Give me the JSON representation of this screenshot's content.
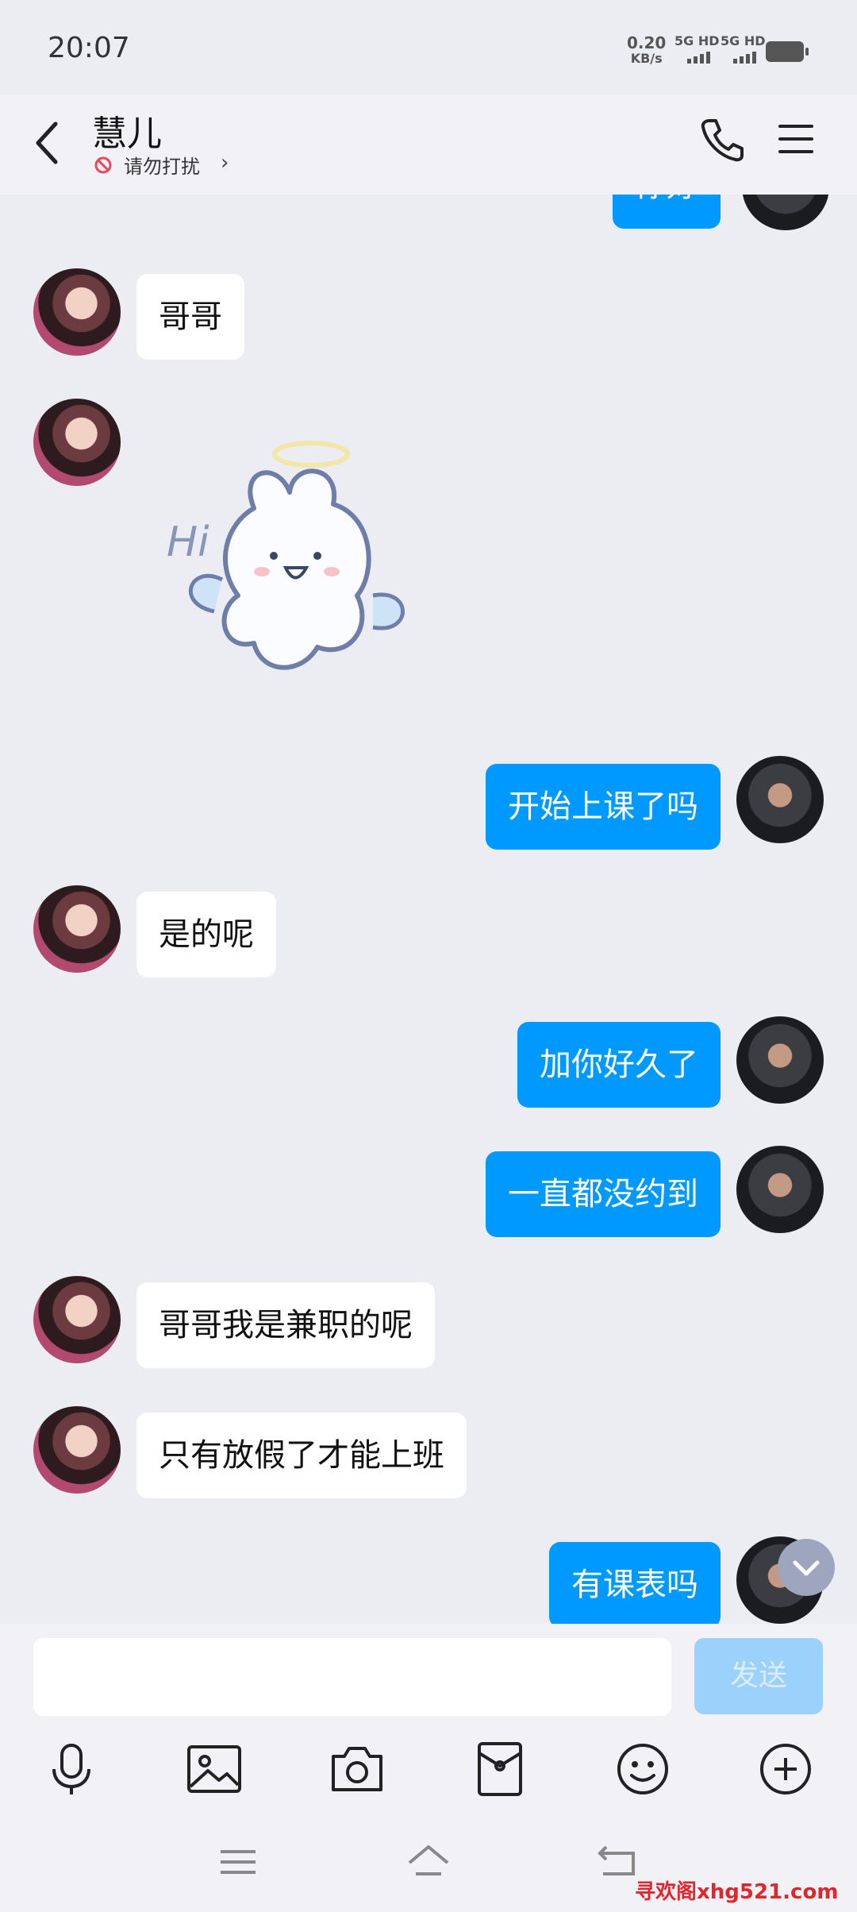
{
  "status_bar": {
    "time": "20:07",
    "net_speed": "0.20",
    "net_unit": "KB/s",
    "signal1": "5G HD",
    "signal2": "5G HD"
  },
  "header": {
    "title": "慧儿",
    "subtitle": "请勿打扰",
    "subtitle_chevron": "›"
  },
  "messages": [
    {
      "side": "right",
      "text": "你好"
    },
    {
      "side": "left",
      "text": "哥哥"
    },
    {
      "side": "left",
      "sticker": "hi-angel-bunny-sticker"
    },
    {
      "side": "right",
      "text": "开始上课了吗"
    },
    {
      "side": "left",
      "text": "是的呢"
    },
    {
      "side": "right",
      "text": "加你好久了"
    },
    {
      "side": "right",
      "text": "一直都没约到"
    },
    {
      "side": "left",
      "text": "哥哥我是兼职的呢"
    },
    {
      "side": "left",
      "text": "只有放假了才能上班"
    },
    {
      "side": "right",
      "text": "有课表吗"
    }
  ],
  "sticker_text": "Hi",
  "input": {
    "value": "",
    "send_label": "发送"
  },
  "toolbar_icons": [
    "microphone-icon",
    "image-icon",
    "camera-icon",
    "red-packet-icon",
    "emoji-icon",
    "plus-icon"
  ],
  "nav_icons": [
    "menu-icon",
    "home-icon",
    "back-icon"
  ],
  "watermark": "寻欢阁xhg521.com",
  "colors": {
    "accent": "#0099FF",
    "background": "#ECECF3",
    "send_disabled": "#9BD1FA"
  }
}
